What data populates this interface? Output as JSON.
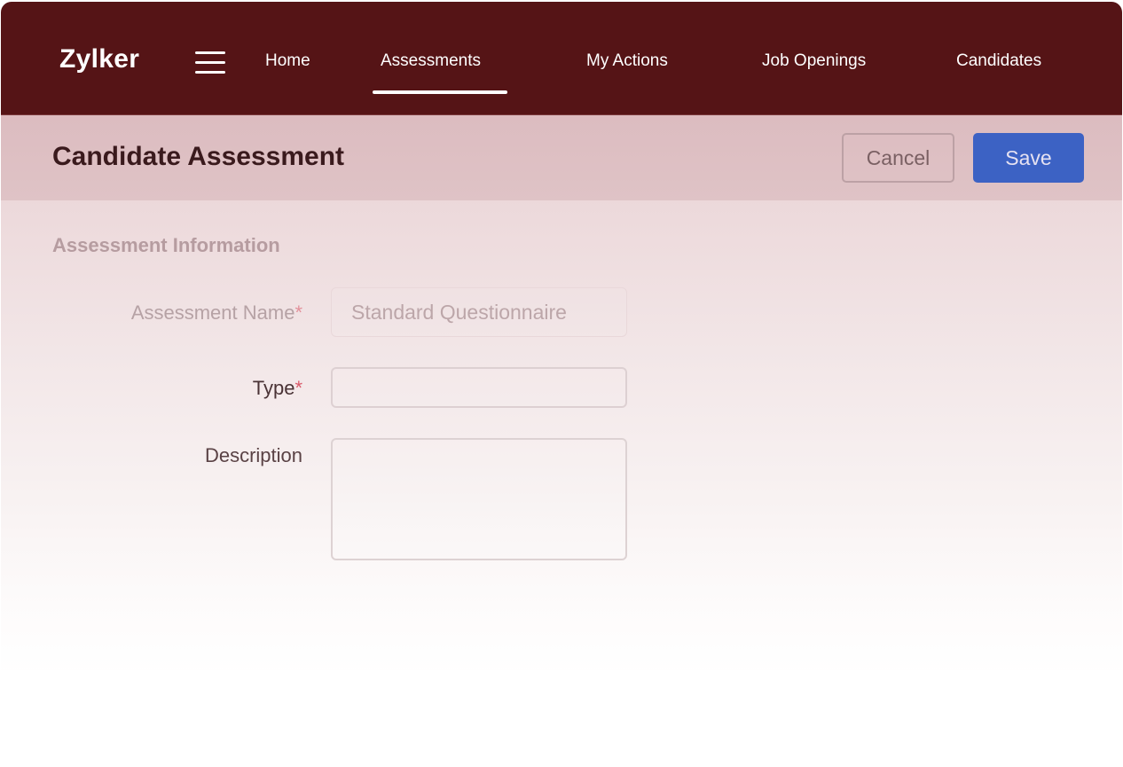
{
  "app": {
    "logo": "Zylker"
  },
  "nav": {
    "items": [
      {
        "label": "Home",
        "active": false
      },
      {
        "label": "Assessments",
        "active": true
      },
      {
        "label": "My Actions",
        "active": false
      },
      {
        "label": "Job Openings",
        "active": false
      },
      {
        "label": "Candidates",
        "active": false
      }
    ]
  },
  "header": {
    "title": "Candidate Assessment",
    "cancel_label": "Cancel",
    "save_label": "Save"
  },
  "form": {
    "section_title": "Assessment Information",
    "fields": [
      {
        "label": "Assessment Name",
        "required": true,
        "required_mark": "*",
        "value": "Standard Questionnaire"
      },
      {
        "label": "Type",
        "required": true,
        "required_mark": "*",
        "value": ""
      },
      {
        "label": "Description",
        "required": false,
        "value": ""
      }
    ]
  },
  "colors": {
    "header_bg": "#551416",
    "subheader_bg": "#dcbcc0",
    "save_button": "#3c62c4",
    "required_asterisk": "#d95a6a"
  }
}
